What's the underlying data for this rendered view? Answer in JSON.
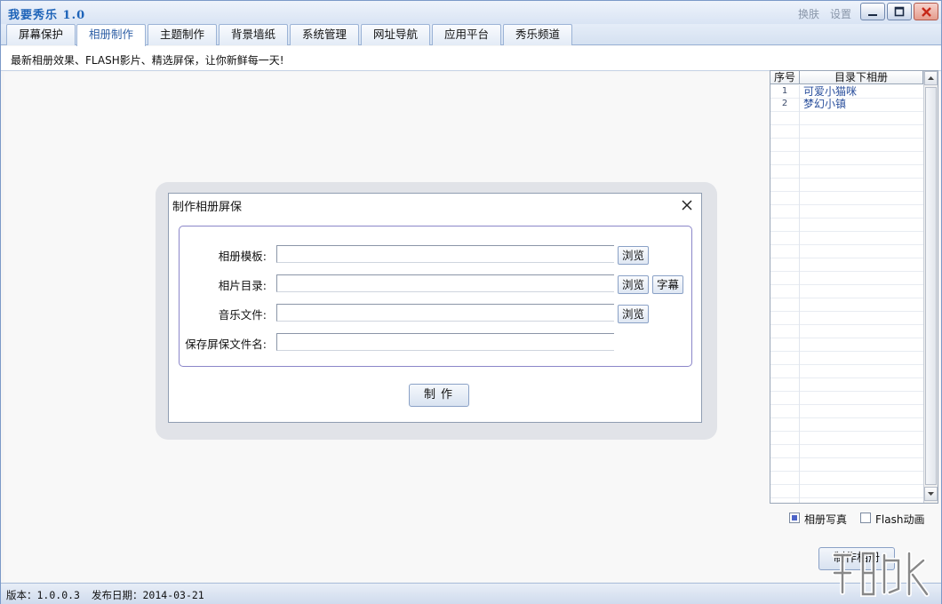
{
  "window": {
    "title": "我要秀乐 1.0",
    "skin_label": "换肤",
    "settings_label": "设置"
  },
  "tabs": [
    {
      "label": "屏幕保护"
    },
    {
      "label": "相册制作"
    },
    {
      "label": "主题制作"
    },
    {
      "label": "背景墙纸"
    },
    {
      "label": "系统管理"
    },
    {
      "label": "网址导航"
    },
    {
      "label": "应用平台"
    },
    {
      "label": "秀乐频道"
    }
  ],
  "active_tab": "相册制作",
  "subtitle": "最新相册效果、FLASH影片、精选屏保，让你新鲜每一天!",
  "album_list": {
    "col_index": "序号",
    "col_name": "目录下相册",
    "rows": [
      {
        "index": "1",
        "name": "可爱小猫咪"
      },
      {
        "index": "2",
        "name": "梦幻小镇"
      }
    ]
  },
  "options": {
    "photo_album": {
      "label": "相册写真",
      "checked": true
    },
    "flash": {
      "label": "Flash动画",
      "checked": false
    }
  },
  "make_album_button": "制作相册",
  "status": {
    "version": "版本：1.0.0.3",
    "release_date": "发布日期：2014-03-21"
  },
  "dialog": {
    "title": "制作相册屏保",
    "fields": {
      "template": {
        "label": "相册模板:",
        "value": ""
      },
      "photo_dir": {
        "label": "相片目录:",
        "value": ""
      },
      "music": {
        "label": "音乐文件:",
        "value": ""
      },
      "save_name": {
        "label": "保存屏保文件名:",
        "value": ""
      }
    },
    "browse_label": "浏览",
    "caption_label": "字幕",
    "make_label": "制作"
  },
  "colors": {
    "title_blue": "#1d63b8",
    "accent": "#4c63c7",
    "close_red": "#d33a2c"
  }
}
